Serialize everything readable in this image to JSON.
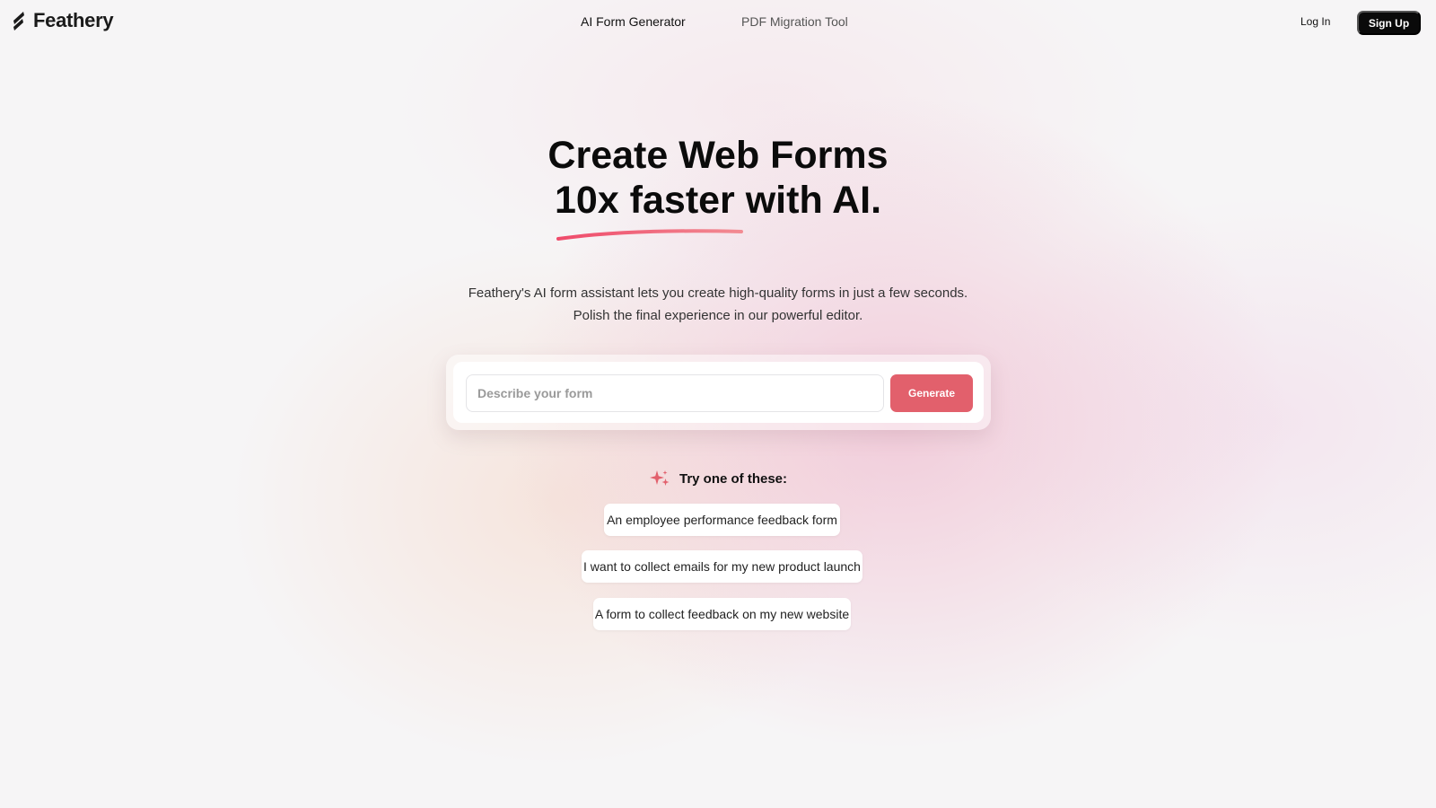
{
  "header": {
    "brand": "Feathery",
    "nav": [
      {
        "label": "AI Form Generator"
      },
      {
        "label": "PDF Migration Tool"
      }
    ],
    "login_label": "Log In",
    "signup_label": "Sign Up"
  },
  "hero": {
    "title_line1": "Create Web Forms",
    "title_line2": "10x faster with AI.",
    "subtitle_line1": "Feathery's AI form assistant lets you create high-quality forms in just a few seconds.",
    "subtitle_line2": "Polish the final experience in our powerful editor."
  },
  "form": {
    "placeholder": "Describe your form",
    "value": "",
    "generate_label": "Generate"
  },
  "suggestions": {
    "heading": "Try one of these:",
    "items": [
      "An employee performance feedback form",
      "I want to collect emails for my new product launch",
      "A form to collect feedback on my new website"
    ]
  },
  "colors": {
    "accent": "#e2606c",
    "underline": "#ef4b6b",
    "dark": "#0a0a0a"
  },
  "icons": {
    "logo": "feather-logo-icon",
    "sparkle": "sparkles-icon"
  }
}
